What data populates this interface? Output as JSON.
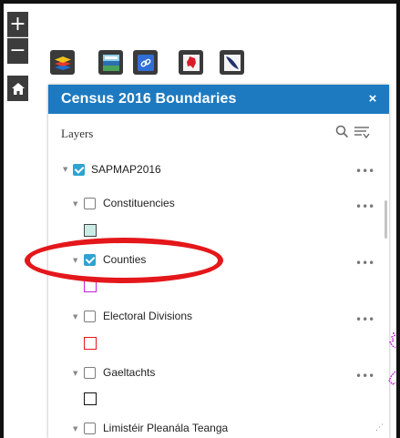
{
  "map_controls": {
    "zoom_in_label": "+",
    "zoom_out_label": "−",
    "home_icon": "home-icon"
  },
  "toolbar": {
    "buttons": [
      {
        "name": "layer-list-icon"
      },
      {
        "name": "census-basemap-icon"
      },
      {
        "name": "link-icon"
      },
      {
        "name": "map-pin-icon"
      },
      {
        "name": "legend-icon"
      }
    ]
  },
  "panel": {
    "title": "Census 2016 Boundaries",
    "close_label": "×",
    "layers_label": "Layers",
    "search_icon": "search-icon",
    "filter_icon": "filter-icon",
    "header_color": "#1d7ac0"
  },
  "layers": {
    "root": {
      "label": "SAPMAP2016",
      "checked": true,
      "more": "•••"
    },
    "items": [
      {
        "label": "Constituencies",
        "checked": false,
        "more": "•••",
        "swatch_fill": "#c9ece6",
        "swatch_border": "#444444"
      },
      {
        "label": "Counties",
        "checked": true,
        "more": "•••",
        "swatch_fill": "#ffffff",
        "swatch_border": "#c21fd4"
      },
      {
        "label": "Electoral Divisions",
        "checked": false,
        "more": "•••",
        "swatch_fill": "#ffffff",
        "swatch_border": "#e8141c"
      },
      {
        "label": "Gaeltachts",
        "checked": false,
        "more": "•••",
        "swatch_fill": "#ffffff",
        "swatch_border": "#111111"
      },
      {
        "label": "Limistéir Pleanála Teanga",
        "checked": false,
        "more": "•••"
      }
    ]
  },
  "annotation": {
    "highlight_color": "#e4171b"
  }
}
